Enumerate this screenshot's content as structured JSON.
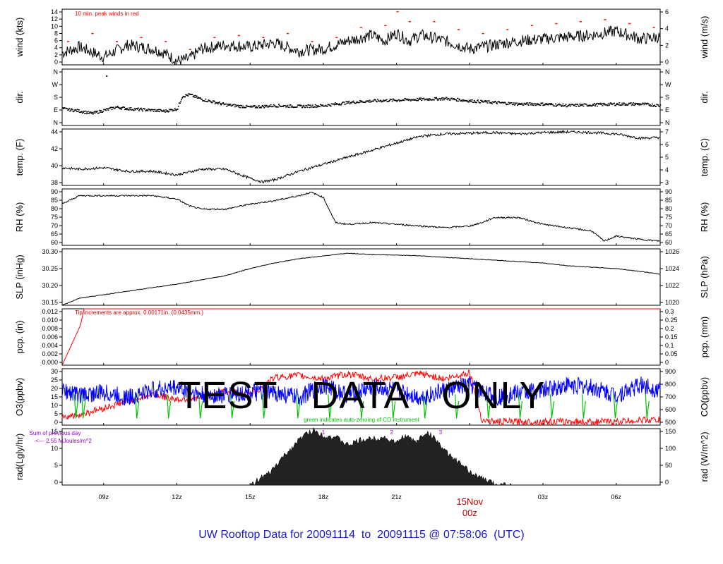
{
  "chart_data": [
    {
      "type": "line",
      "id": "wind",
      "ylabel_left": "wind (kts)",
      "ylabel_right": "wind (m/s)",
      "yticks_left": [
        "0",
        "2",
        "4",
        "6",
        "8",
        "10",
        "12",
        "14"
      ],
      "yticks_right": [
        "0",
        "2",
        "4",
        "6"
      ],
      "ylim": [
        0,
        14
      ],
      "annotation": "10 min. peak winds in red",
      "series": [
        {
          "key": "speed",
          "color": "#000000",
          "x": [
            7.3,
            8,
            9,
            10,
            11,
            11.5,
            12,
            12.5,
            13,
            14,
            15,
            16,
            17,
            18,
            19,
            20,
            20.5,
            21,
            21.5,
            22,
            23,
            24,
            25,
            26,
            27,
            28,
            29,
            30,
            31,
            31.8
          ],
          "values": [
            3,
            4.5,
            2,
            5,
            4,
            3,
            1,
            1.5,
            4,
            5,
            4.5,
            5.5,
            3.5,
            4,
            6,
            7.5,
            6,
            8,
            6,
            7.5,
            6,
            4,
            5,
            6,
            6.5,
            7,
            7.5,
            8.5,
            6.5,
            7
          ]
        },
        {
          "key": "peak",
          "color": "#ff0000",
          "x": [
            7.5,
            8.5,
            9.5,
            10.5,
            11.5,
            12.5,
            13.5,
            14.5,
            15.5,
            16.5,
            17.5,
            18.5,
            19.5,
            20.5,
            21,
            21.5,
            22.5,
            23.5,
            24.5,
            25.5,
            26.5,
            27.5,
            28.5,
            29.5,
            30.5,
            31.5
          ],
          "values": [
            6,
            8,
            6,
            7,
            6,
            4,
            7,
            7.5,
            7,
            8,
            6,
            7,
            9.5,
            10,
            13.5,
            11,
            11,
            9,
            8,
            9,
            10,
            10.5,
            11,
            11.5,
            10.5,
            9.5
          ]
        }
      ]
    },
    {
      "type": "scatter",
      "id": "dir",
      "ylabel_left": "dir.",
      "ylabel_right": "dir.",
      "yticks_left": [
        "N",
        "E",
        "S",
        "W",
        "N"
      ],
      "yticks_right": [
        "N",
        "E",
        "S",
        "W",
        "N"
      ],
      "ylim": [
        0,
        360
      ],
      "series": [
        {
          "key": "direction",
          "color": "#000000",
          "x": [
            7.3,
            8,
            8.5,
            9,
            9.5,
            10,
            11,
            11.5,
            12,
            12.2,
            12.5,
            13,
            14,
            15,
            16,
            17,
            18,
            19,
            20,
            21,
            22,
            23,
            24,
            25,
            26,
            27,
            28,
            29,
            30,
            31,
            31.8
          ],
          "values": [
            110,
            95,
            80,
            100,
            120,
            110,
            100,
            95,
            110,
            190,
            200,
            170,
            135,
            120,
            130,
            125,
            130,
            150,
            160,
            165,
            170,
            175,
            160,
            150,
            140,
            140,
            130,
            135,
            140,
            140,
            130
          ]
        }
      ]
    },
    {
      "type": "line",
      "id": "temp",
      "ylabel_left": "temp. (F)",
      "ylabel_right": "temp. (C)",
      "yticks_left": [
        "38",
        "40",
        "42",
        "44"
      ],
      "yticks_right": [
        "3",
        "4",
        "5",
        "6",
        "7"
      ],
      "ylim": [
        37.5,
        45.5
      ],
      "series": [
        {
          "key": "temperature",
          "color": "#000000",
          "x": [
            7.3,
            8,
            9,
            10,
            11,
            12,
            13,
            14,
            15,
            15.5,
            16,
            17,
            18,
            19,
            20,
            21,
            22,
            23,
            24,
            25,
            26,
            27,
            28,
            29,
            30,
            31,
            31.8
          ],
          "values": [
            40,
            39.8,
            40,
            39.5,
            39.5,
            39,
            39.8,
            39.8,
            38.5,
            38,
            38.3,
            39.5,
            40.5,
            41.5,
            42.5,
            43.5,
            44.5,
            44.8,
            44.9,
            45,
            44.8,
            45,
            45.1,
            45,
            44.8,
            44.2,
            44.3
          ]
        }
      ]
    },
    {
      "type": "line",
      "id": "rh",
      "ylabel_left": "RH (%)",
      "ylabel_right": "RH (%)",
      "yticks_left": [
        "60",
        "65",
        "70",
        "75",
        "80",
        "85",
        "90"
      ],
      "yticks_right": [
        "60",
        "65",
        "70",
        "75",
        "80",
        "85",
        "90"
      ],
      "ylim": [
        58.5,
        92
      ],
      "series": [
        {
          "key": "humidity",
          "color": "#000000",
          "x": [
            7.3,
            8,
            9,
            10,
            11,
            12,
            12.5,
            13,
            14,
            15,
            16,
            17,
            17.5,
            18,
            18.5,
            19,
            20,
            21,
            22,
            23,
            24,
            24.5,
            25,
            26,
            27,
            28,
            29,
            29.5,
            30,
            31,
            31.8
          ],
          "values": [
            83,
            88,
            88,
            88,
            88,
            86,
            82,
            80,
            80,
            83,
            85,
            88,
            90,
            87,
            72,
            71,
            72,
            71,
            70,
            69,
            70,
            72,
            75,
            75,
            71,
            69,
            67,
            61,
            64,
            62,
            61
          ]
        }
      ]
    },
    {
      "type": "line",
      "id": "slp",
      "ylabel_left": "SLP (inHg)",
      "ylabel_right": "SLP (hPa)",
      "yticks_left": [
        "30.15",
        "30.20",
        "30.25",
        "30.30"
      ],
      "yticks_right": [
        "1020",
        "1022",
        "1024",
        "1026"
      ],
      "ylim": [
        30.13,
        30.33
      ],
      "series": [
        {
          "key": "pressure",
          "color": "#000000",
          "x": [
            7.3,
            8,
            10,
            12,
            14,
            15,
            16,
            17,
            18,
            19,
            20,
            21,
            22,
            23,
            24,
            25,
            26,
            27,
            28,
            29,
            30,
            31,
            31.8
          ],
          "values": [
            30.13,
            30.155,
            30.18,
            30.205,
            30.235,
            30.26,
            30.28,
            30.295,
            30.305,
            30.315,
            30.31,
            30.308,
            30.305,
            30.3,
            30.295,
            30.29,
            30.285,
            30.28,
            30.27,
            30.265,
            30.26,
            30.25,
            30.24
          ]
        }
      ]
    },
    {
      "type": "line",
      "id": "pcp",
      "ylabel_left": "pcp. (in)",
      "ylabel_right": "pcp. (mm)",
      "yticks_left": [
        "0.000",
        "0.002",
        "0.004",
        "0.006",
        "0.008",
        "0.010",
        "0.012"
      ],
      "yticks_right": [
        "0",
        "0.05",
        "0.1",
        "0.15",
        "0.2",
        "0.25",
        "0.3"
      ],
      "ylim": [
        0,
        0.012
      ],
      "annotation": "Tip increments are approx. 0.00171in. (0.0435mm.)",
      "series": [
        {
          "key": "precip",
          "color": "#ff0000",
          "x": [
            7.3,
            7.45,
            7.6,
            7.75,
            7.9,
            8.05,
            8.2,
            31.8
          ],
          "values": [
            0,
            0.0017,
            0.0034,
            0.0051,
            0.0068,
            0.0085,
            0.012,
            0.012
          ]
        }
      ]
    },
    {
      "type": "line",
      "id": "gas",
      "ylabel_left": "O3(ppbv)",
      "ylabel_right": "CO(ppbv)",
      "yticks_left": [
        "0",
        "5",
        "10",
        "15",
        "20",
        "25",
        "30"
      ],
      "yticks_right": [
        "500",
        "600",
        "700",
        "800",
        "900"
      ],
      "ylim": [
        0,
        33
      ],
      "annotation": "green indicates auto-zeroing of CO instrument",
      "series": [
        {
          "key": "o3",
          "color": "#ff0000",
          "x": [
            7.3,
            8,
            9,
            10,
            11,
            12,
            13,
            14,
            15,
            15.5,
            16,
            17,
            18,
            19,
            20,
            21,
            22,
            23,
            24,
            24.5,
            25,
            26,
            27,
            28,
            29,
            30,
            31,
            31.8
          ],
          "values": [
            5,
            6,
            10,
            14,
            18,
            15,
            16,
            20,
            18,
            22,
            28,
            29,
            27,
            30,
            27,
            28,
            30,
            27,
            31,
            3,
            2,
            2,
            2,
            2,
            2,
            2,
            3,
            3
          ]
        },
        {
          "key": "co",
          "color": "#0000ff",
          "x": [
            7.3,
            8,
            9,
            10,
            11,
            12,
            13,
            14,
            15,
            16,
            17,
            18,
            19,
            20,
            21,
            22,
            23,
            24,
            25,
            26,
            27,
            28,
            29,
            30,
            31,
            31.8
          ],
          "values": [
            760,
            720,
            740,
            700,
            760,
            780,
            720,
            720,
            740,
            740,
            700,
            800,
            720,
            780,
            760,
            700,
            760,
            800,
            700,
            740,
            760,
            800,
            780,
            720,
            800,
            760
          ]
        },
        {
          "key": "co_zero",
          "color": "#00c000",
          "x": [
            7.8,
            8.1,
            10.3,
            11.6,
            12.9,
            14.2,
            15.5,
            16.9,
            18.2,
            19.5,
            20.8,
            22.1,
            23.4,
            24.7,
            26,
            27.3,
            28.6,
            29.9,
            31.2
          ],
          "values": [
            600,
            590,
            620,
            600,
            610,
            620,
            600,
            600,
            630,
            610,
            620,
            600,
            610,
            600,
            610,
            620,
            600,
            600,
            610
          ]
        }
      ]
    },
    {
      "type": "area",
      "id": "rad",
      "ylabel_left": "rad(Lgly/hr)",
      "ylabel_right": "rad (W/m^2)",
      "yticks_left": [
        "0",
        "5",
        "10",
        "15"
      ],
      "yticks_right": [
        "0",
        "50",
        "100",
        "150"
      ],
      "ylim": [
        0,
        17
      ],
      "annotation": "Sum of previous day",
      "annotation2": "<--- 2.55 MJoules/m^2",
      "markers": [
        "1",
        "2",
        "3"
      ],
      "marker_x": [
        18,
        20.8,
        22.8
      ],
      "series": [
        {
          "key": "radiation",
          "color": "#000000",
          "x": [
            15,
            15.3,
            15.8,
            16.3,
            16.8,
            17.2,
            17.6,
            18,
            18.5,
            19,
            19.5,
            20,
            20.5,
            21,
            21.3,
            21.8,
            22.2,
            22.6,
            23,
            23.5,
            24,
            24.5,
            25,
            25.7
          ],
          "values": [
            0,
            1.5,
            3.5,
            8,
            12,
            15,
            16.5,
            15,
            14.5,
            12,
            13.5,
            14,
            14.5,
            12.5,
            15,
            13,
            16,
            14,
            10,
            7,
            4,
            2,
            0.5,
            0
          ]
        }
      ]
    }
  ],
  "x_axis": {
    "range_hours": [
      7.3,
      31.8
    ],
    "ticks": [
      {
        "hour": 9,
        "label": "09z"
      },
      {
        "hour": 12,
        "label": "12z"
      },
      {
        "hour": 15,
        "label": "15z"
      },
      {
        "hour": 18,
        "label": "18z"
      },
      {
        "hour": 21,
        "label": "21z"
      },
      {
        "hour": 24,
        "label": "15Nov",
        "label2": "00z",
        "highlight": true
      },
      {
        "hour": 27,
        "label": "03z"
      },
      {
        "hour": 30,
        "label": "06z"
      }
    ]
  },
  "watermark": "TEST   DATA   ONLY",
  "footer": "UW Rooftop Data for 20091114  to  20091115 @ 07:58:06  (UTC)",
  "colors": {
    "peak": "#ff0000",
    "o3": "#ff0000",
    "co": "#0000ff",
    "zero": "#00c000",
    "rad_note": "#9900cc",
    "footer": "#1a1ac8"
  }
}
